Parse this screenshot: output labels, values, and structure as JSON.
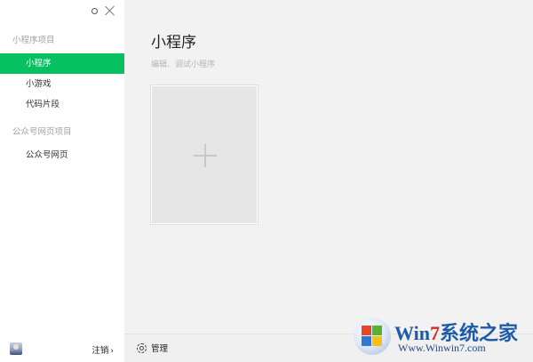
{
  "sidebar": {
    "sections": [
      {
        "title": "小程序项目",
        "items": [
          {
            "label": "小程序"
          },
          {
            "label": "小游戏"
          },
          {
            "label": "代码片段"
          }
        ]
      },
      {
        "title": "公众号网页项目",
        "items": [
          {
            "label": "公众号网页"
          }
        ]
      }
    ],
    "active_item": "小程序",
    "footer": {
      "logout_label": "注销",
      "logout_chevron": "›"
    }
  },
  "main": {
    "title": "小程序",
    "subtitle": "编辑、调试小程序",
    "footer": {
      "manage_label": "管理"
    }
  },
  "watermark": {
    "brand_win": "Win",
    "brand_seven": "7",
    "brand_rest": "系统之家",
    "url": "Www.Winwin7.com"
  },
  "colors": {
    "accent": "#07c160",
    "sidebar_bg": "#ffffff",
    "main_bg": "#f2f2f2"
  },
  "icons": [
    "settings-dot-icon",
    "close-icon",
    "avatar-icon",
    "chevron-right-icon",
    "plus-icon",
    "gear-icon",
    "windows-logo-icon"
  ]
}
